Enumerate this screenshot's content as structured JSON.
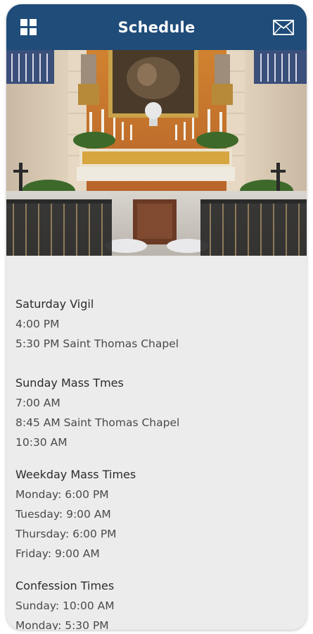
{
  "appbar": {
    "title": "Schedule",
    "menu_icon": "grid-menu-icon",
    "mail_icon": "envelope-icon",
    "color": "#1f4c79"
  },
  "hero": {
    "image": "church-altar-photo"
  },
  "schedule": {
    "saturday": {
      "title": "Saturday Vigil",
      "lines": [
        "4:00 PM",
        "5:30 PM Saint Thomas Chapel"
      ]
    },
    "sunday": {
      "title": "Sunday Mass Tmes",
      "lines": [
        "7:00 AM",
        "8:45 AM Saint Thomas Chapel",
        "10:30 AM"
      ]
    },
    "weekday": {
      "title": "Weekday Mass Times",
      "lines": [
        "Monday: 6:00 PM",
        "Tuesday: 9:00 AM",
        "Thursday: 6:00 PM",
        "Friday: 9:00 AM"
      ]
    },
    "confession": {
      "title": "Confession Times",
      "lines": [
        "Sunday: 10:00 AM",
        "Monday: 5:30 PM"
      ]
    }
  }
}
